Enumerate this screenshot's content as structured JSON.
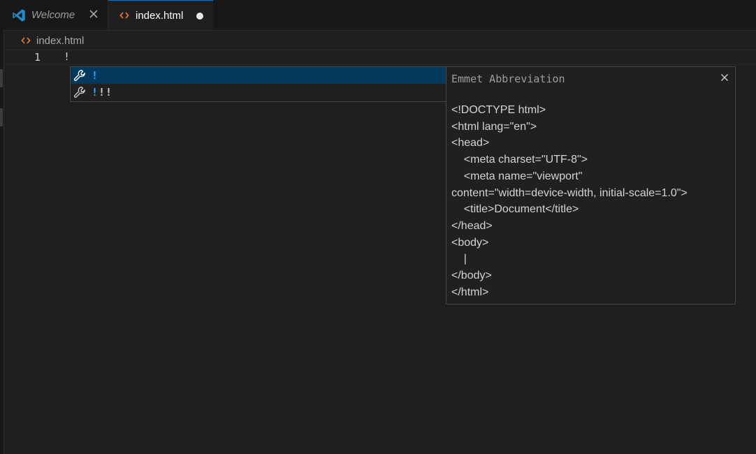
{
  "tabs": [
    {
      "label": "Welcome",
      "icon": "vscode-logo-icon",
      "italic": true
    },
    {
      "label": "index.html",
      "icon": "html-file-icon",
      "dirty": true,
      "active": true
    }
  ],
  "breadcrumb": {
    "file": "index.html",
    "icon": "html-file-icon"
  },
  "editor": {
    "line_number": "1",
    "line_text": "!"
  },
  "suggestions": [
    {
      "prefix": "",
      "match": "!",
      "rest": "",
      "icon": "wrench-icon",
      "selected": true
    },
    {
      "prefix": "",
      "match": "!",
      "rest": "!!",
      "icon": "wrench-icon",
      "selected": false
    }
  ],
  "details": {
    "title": "Emmet Abbreviation",
    "lines": [
      "<!DOCTYPE html>",
      "<html lang=\"en\">",
      "<head>",
      "\t<meta charset=\"UTF-8\">",
      "\t<meta name=\"viewport\"",
      "content=\"width=device-width, initial-scale=1.0\">",
      "\t<title>Document</title>",
      "</head>",
      "<body>",
      "\t|",
      "</body>",
      "</html>"
    ]
  },
  "colors": {
    "accent": "#0078d4",
    "match_highlight": "#2aaaff",
    "selected_row": "#04395e",
    "html_icon": "#e37933",
    "vscode_blue": "#2489ca"
  }
}
